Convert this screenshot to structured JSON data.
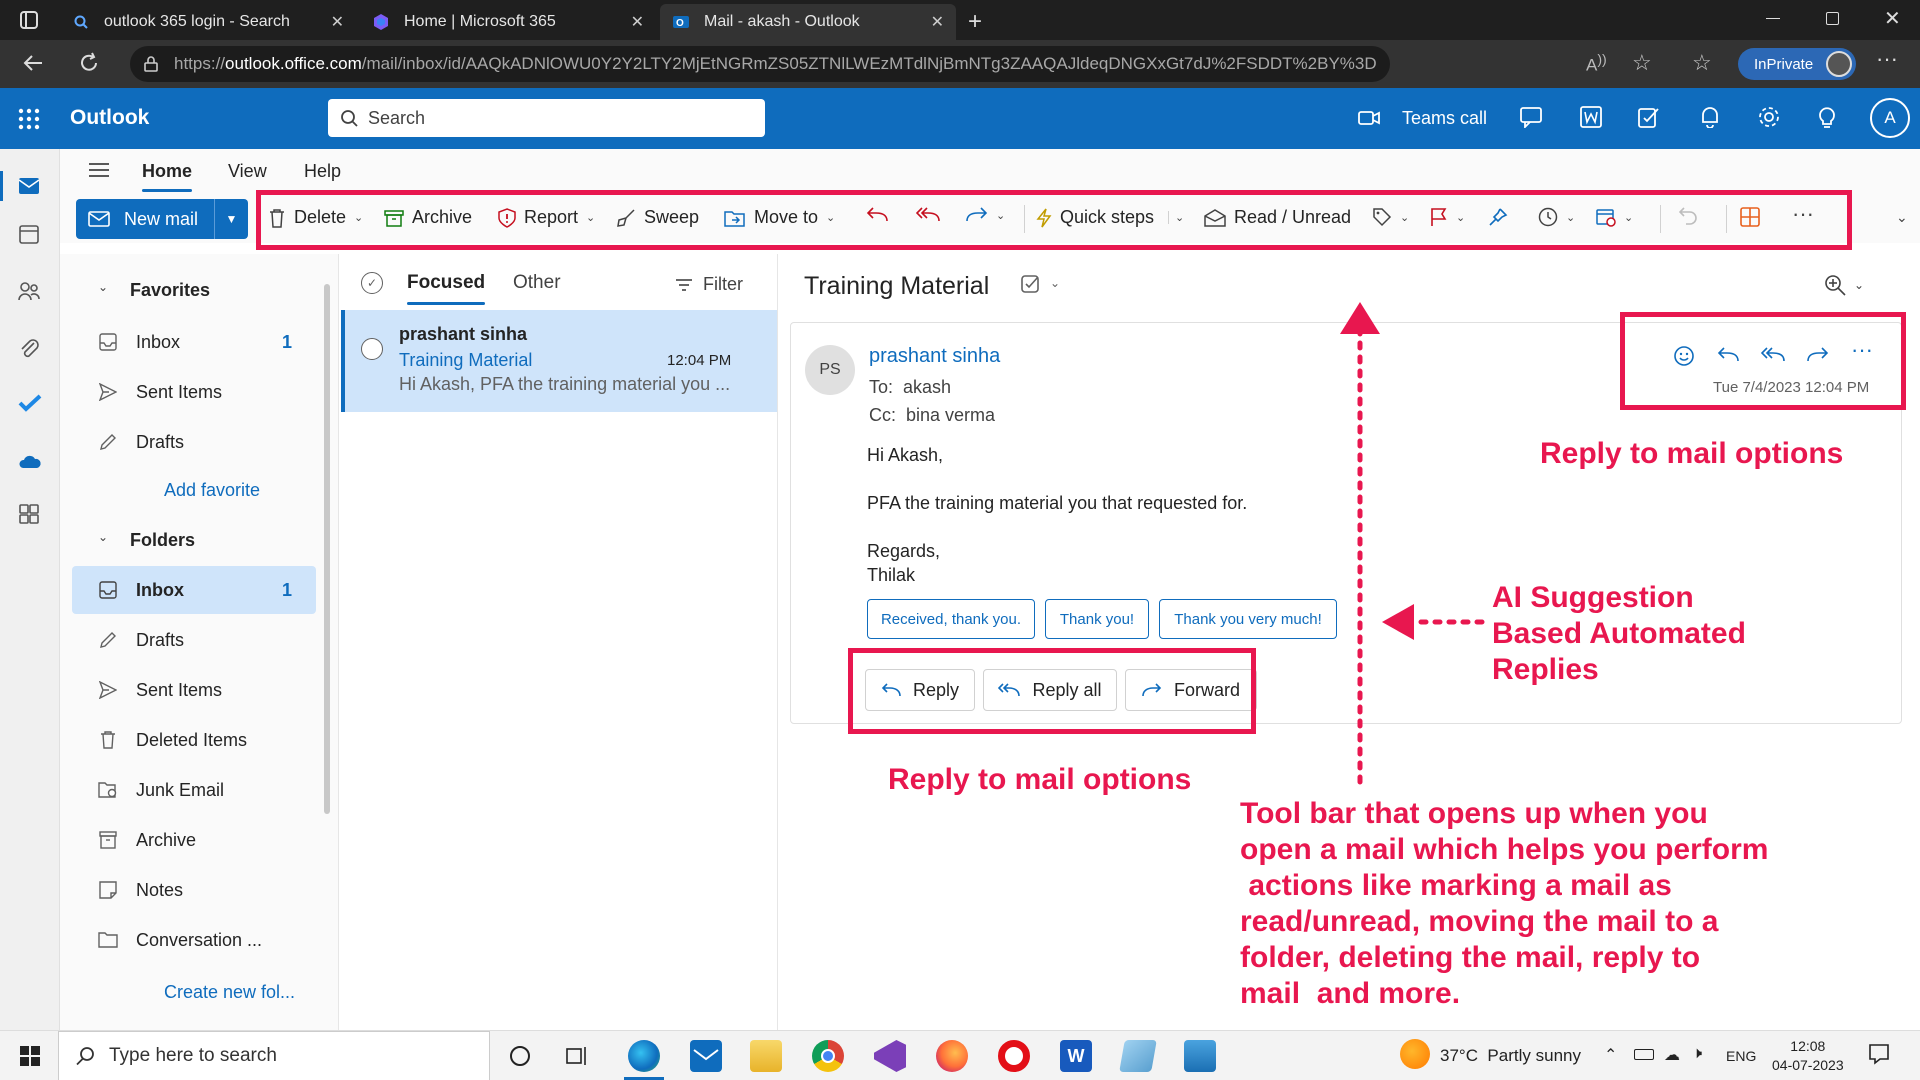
{
  "browser": {
    "tabs": [
      {
        "title": "outlook 365 login - Search",
        "icon": "search-icon"
      },
      {
        "title": "Home | Microsoft 365",
        "icon": "m365-logo"
      },
      {
        "title": "Mail - akash - Outlook",
        "icon": "outlook-logo"
      }
    ],
    "url_prefix": "https://",
    "url_host": "outlook.office.com",
    "url_path": "/mail/inbox/id/AAQkADNlOWU0Y2Y2LTY2MjEtNGRmZS05ZTNlLWEzMTdlNjBmNTg3ZAAQAJldeqDNGXxGt7dJ%2FSDDT%2BY%3D",
    "inprivate_label": "InPrivate"
  },
  "outlook": {
    "app_name": "Outlook",
    "search_placeholder": "Search",
    "teams_call_label": "Teams call",
    "avatar_initial": "A"
  },
  "ribbon": {
    "tabs": [
      "Home",
      "View",
      "Help"
    ],
    "new_mail": "New mail",
    "delete": "Delete",
    "archive": "Archive",
    "report": "Report",
    "sweep": "Sweep",
    "move_to": "Move to",
    "quick_steps": "Quick steps",
    "read_unread": "Read / Unread"
  },
  "folders": {
    "favorites_header": "Favorites",
    "favorites": [
      {
        "name": "Inbox",
        "count": "1"
      },
      {
        "name": "Sent Items",
        "count": ""
      },
      {
        "name": "Drafts",
        "count": ""
      }
    ],
    "add_favorite": "Add favorite",
    "folders_header": "Folders",
    "items": [
      {
        "name": "Inbox",
        "count": "1"
      },
      {
        "name": "Drafts",
        "count": ""
      },
      {
        "name": "Sent Items",
        "count": ""
      },
      {
        "name": "Deleted Items",
        "count": ""
      },
      {
        "name": "Junk Email",
        "count": ""
      },
      {
        "name": "Archive",
        "count": ""
      },
      {
        "name": "Notes",
        "count": ""
      },
      {
        "name": "Conversation ...",
        "count": ""
      }
    ],
    "create_new": "Create new fol..."
  },
  "message_list": {
    "tab_focused": "Focused",
    "tab_other": "Other",
    "filter": "Filter",
    "messages": [
      {
        "sender": "prashant sinha",
        "subject": "Training Material",
        "time": "12:04 PM",
        "preview": "Hi Akash, PFA the training material you ..."
      }
    ]
  },
  "reading": {
    "subject": "Training Material",
    "avatar_initials": "PS",
    "sender": "prashant sinha",
    "to_label": "To:",
    "to": "akash",
    "cc_label": "Cc:",
    "cc": "bina verma",
    "date": "Tue 7/4/2023 12:04 PM",
    "body": [
      "Hi Akash,",
      "PFA the training material you that requested for.",
      "Regards,",
      "Thilak"
    ],
    "suggestions": [
      "Received, thank you.",
      "Thank you!",
      "Thank you very much!"
    ],
    "reply": "Reply",
    "reply_all": "Reply all",
    "forward": "Forward"
  },
  "annotations": {
    "reply_options_top": "Reply to mail options",
    "ai_line1": "AI Suggestion",
    "ai_line2": "Based Automated",
    "ai_line3": "Replies",
    "reply_options_bottom": "Reply to mail options",
    "toolbar_lines": [
      "Tool bar that opens up when you",
      "open a mail which helps you perform",
      " actions like marking a mail as",
      "read/unread, moving the mail to a",
      "folder, deleting the mail, reply to",
      "mail  and more."
    ],
    "color": "#e8174f"
  },
  "taskbar": {
    "search_placeholder": "Type here to search",
    "weather": "37°C  Partly sunny",
    "language": "ENG",
    "time": "12:08",
    "date": "04-07-2023"
  },
  "colors": {
    "accent": "#0f6cbd",
    "selected": "#cfe4fa"
  }
}
